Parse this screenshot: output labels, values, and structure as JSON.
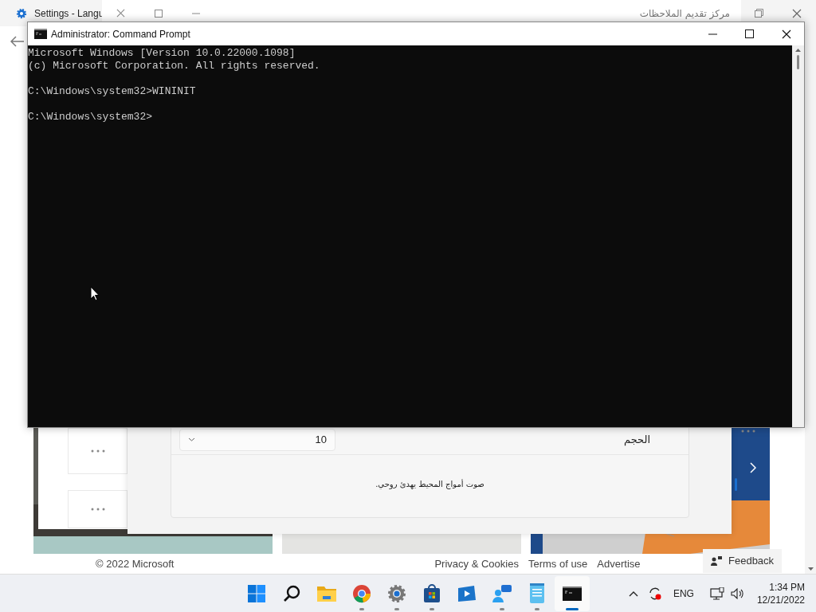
{
  "settings_window": {
    "title": "Settings - Langu"
  },
  "feedback_window": {
    "title": "مركز تقديم الملاحظات",
    "volume_label": "الحجم",
    "volume_value": "10",
    "sample_text": "صوت أمواج المحيط يهدئ روحي."
  },
  "browser_page": {
    "copyright": "© 2022 Microsoft",
    "footer_links": [
      "Privacy & Cookies",
      "Terms of use",
      "Advertise"
    ],
    "feedback_button": "Feedback"
  },
  "cmd_window": {
    "title": "Administrator: Command Prompt",
    "blocks": [
      [
        "Microsoft Windows [Version 10.0.22000.1098]",
        "(c) Microsoft Corporation. All rights reserved."
      ],
      [
        "C:\\Windows\\system32>WININIT"
      ],
      [
        "C:\\Windows\\system32>"
      ]
    ]
  },
  "taskbar": {
    "apps": [
      {
        "kind": "start",
        "running": false,
        "active": false
      },
      {
        "kind": "search",
        "running": false,
        "active": false
      },
      {
        "kind": "folder",
        "running": false,
        "active": false
      },
      {
        "kind": "chrome",
        "running": true,
        "active": false
      },
      {
        "kind": "settings",
        "running": true,
        "active": false
      },
      {
        "kind": "store",
        "running": true,
        "active": false
      },
      {
        "kind": "video",
        "running": false,
        "active": false
      },
      {
        "kind": "chat",
        "running": true,
        "active": false
      },
      {
        "kind": "notepad",
        "running": true,
        "active": false
      },
      {
        "kind": "terminal",
        "running": true,
        "active": true
      }
    ],
    "language": "ENG",
    "time": "1:34 PM",
    "date": "12/21/2022"
  }
}
